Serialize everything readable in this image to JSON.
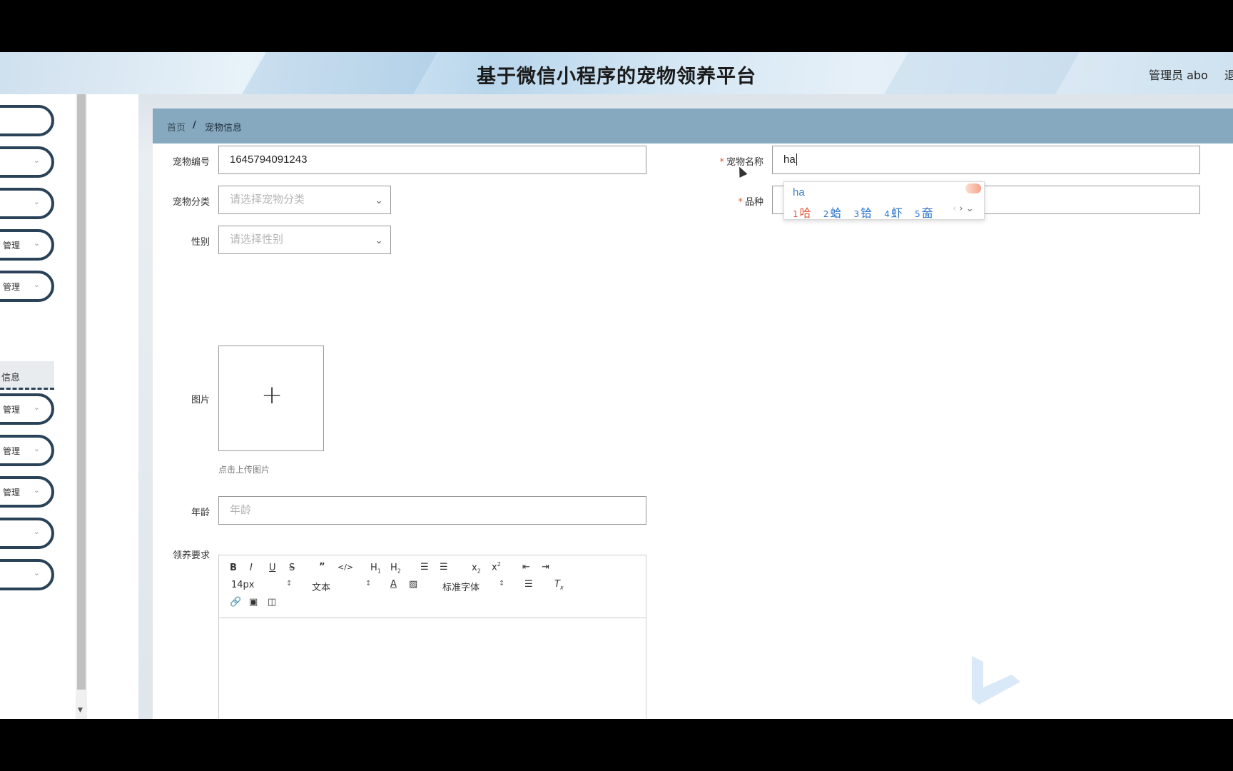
{
  "header": {
    "title": "基于微信小程序的宠物领养平台",
    "user": "管理员 abo",
    "logout": "退出"
  },
  "sidebar": {
    "items": [
      {
        "label": "",
        "expandable": false
      },
      {
        "label": "",
        "expandable": true
      },
      {
        "label": "",
        "expandable": true
      },
      {
        "label": "管理",
        "expandable": true
      },
      {
        "label": "管理",
        "expandable": true
      },
      {
        "label": "管理",
        "expandable": true
      },
      {
        "label": "管理",
        "expandable": true
      },
      {
        "label": "管理",
        "expandable": true
      },
      {
        "label": "",
        "expandable": true
      },
      {
        "label": "",
        "expandable": true
      }
    ],
    "active_sub": "信息"
  },
  "breadcrumb": {
    "home": "首页",
    "separator": "/",
    "current": "宠物信息"
  },
  "form": {
    "pet_id": {
      "label": "宠物编号",
      "value": "1645794091243"
    },
    "pet_name": {
      "label": "宠物名称",
      "value": "ha",
      "required": true
    },
    "category": {
      "label": "宠物分类",
      "placeholder": "请选择宠物分类"
    },
    "breed": {
      "label": "品种",
      "placeholder": "品种",
      "required": true
    },
    "gender": {
      "label": "性别",
      "placeholder": "请选择性别"
    },
    "image": {
      "label": "图片",
      "hint": "点击上传图片"
    },
    "age": {
      "label": "年龄",
      "placeholder": "年龄"
    },
    "requirements": {
      "label": "领养要求"
    }
  },
  "editor": {
    "font_size": "14px",
    "block_type": "文本",
    "font_family": "标准字体"
  },
  "ime": {
    "pinyin": "ha",
    "candidates": [
      {
        "n": "1",
        "c": "哈"
      },
      {
        "n": "2",
        "c": "蛤"
      },
      {
        "n": "3",
        "c": "铪"
      },
      {
        "n": "4",
        "c": "虾"
      },
      {
        "n": "5",
        "c": "奤"
      }
    ]
  },
  "colors": {
    "sidebar_border": "#2a4257",
    "breadcrumb_bg": "#86a9bf",
    "required": "#e2563c"
  }
}
